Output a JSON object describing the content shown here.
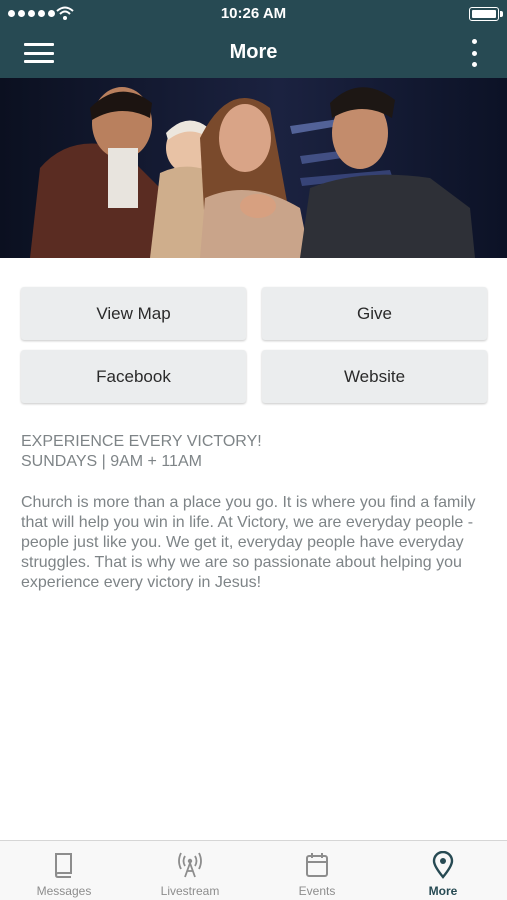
{
  "status_bar": {
    "time": "10:26 AM"
  },
  "header": {
    "title": "More"
  },
  "actions": {
    "view_map": "View Map",
    "give": "Give",
    "facebook": "Facebook",
    "website": "Website"
  },
  "content": {
    "tagline_line1": "EXPERIENCE EVERY VICTORY!",
    "tagline_line2": "SUNDAYS | 9AM + 11AM",
    "description": "Church is more than a place you go. It is where you find a family that will help you win in life. At Victory, we are everyday people - people just like you. We get it, everyday people have everyday struggles. That is why we are so passionate about helping you experience every victory in Jesus!"
  },
  "tabs": [
    {
      "label": "Messages",
      "icon": "book-icon"
    },
    {
      "label": "Livestream",
      "icon": "broadcast-icon"
    },
    {
      "label": "Events",
      "icon": "calendar-icon"
    },
    {
      "label": "More",
      "icon": "location-pin-icon",
      "active": true
    }
  ],
  "colors": {
    "header_bg": "#274a53",
    "button_bg": "#ebedee",
    "body_text": "#7e8487",
    "tab_active": "#274a53",
    "tab_inactive": "#8d8d8d"
  }
}
